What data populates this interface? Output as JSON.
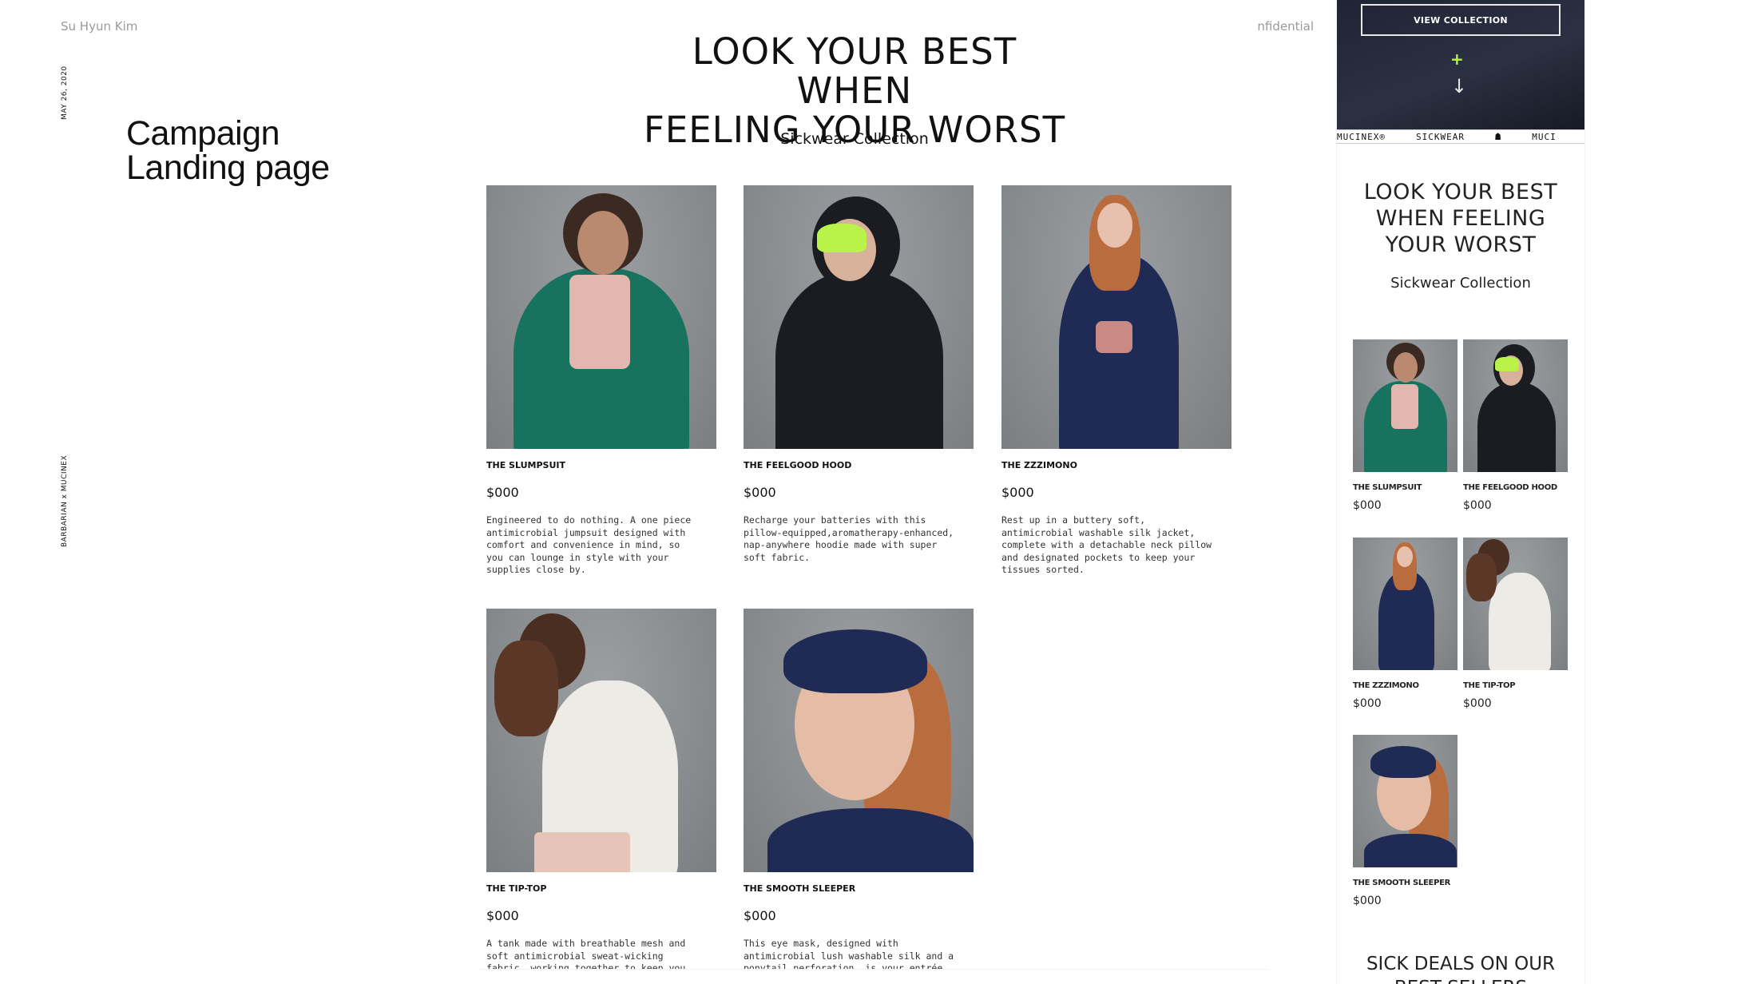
{
  "meta": {
    "author": "Su Hyun Kim",
    "confidential": "Confidential",
    "date": "MAY 26, 2020",
    "brand": "BARBARIAN x MUCINEX",
    "slide_title_line1": "Campaign",
    "slide_title_line2": "Landing page"
  },
  "landing": {
    "headline_line1": "LOOK YOUR BEST WHEN",
    "headline_line2": "FEELING YOUR WORST",
    "subhead": "Sickwear Collection",
    "products": [
      {
        "name": "THE SLUMPSUIT",
        "price": "$000",
        "description": "Engineered to do nothing. A one piece antimicrobial jumpsuit designed with comfort and convenience in mind, so you can lounge in style with your supplies close by."
      },
      {
        "name": "THE FEELGOOD HOOD",
        "price": "$000",
        "description": "Recharge your batteries with this pillow-equipped,aromatherapy-enhanced, nap-anywhere hoodie made with super soft fabric."
      },
      {
        "name": "THE ZZZIMONO",
        "price": "$000",
        "description": "Rest up in a buttery soft, antimicrobial washable silk jacket, complete with a detachable neck pillow and designated pockets to keep your tissues sorted."
      },
      {
        "name": "THE TIP-TOP",
        "price": "$000",
        "description": "A tank made with breathable mesh and soft antimicrobial sweat-wicking fabric, working together to keep you"
      },
      {
        "name": "THE  SMOOTH SLEEPER",
        "price": "$000",
        "description": "This eye mask, designed with antimicrobial lush washable silk and a ponytail perforation, is your entrée"
      }
    ]
  },
  "mobile": {
    "view_collection": "VIEW COLLECTION",
    "plus_icon": "+",
    "arrow_icon": "↓",
    "ticker": [
      "MUCINEX®",
      "SICKWEAR",
      "MUCI"
    ],
    "headline": "LOOK YOUR BEST WHEN FEELING YOUR WORST",
    "subhead": "Sickwear Collection",
    "products": [
      {
        "name": "THE SLUMPSUIT",
        "price": "$000"
      },
      {
        "name": "THE FEELGOOD HOOD",
        "price": "$000"
      },
      {
        "name": "THE ZZZIMONO",
        "price": "$000"
      },
      {
        "name": "THE TIP-TOP",
        "price": "$000"
      },
      {
        "name": "THE  SMOOTH SLEEPER",
        "price": "$000"
      }
    ],
    "deals": "SICK DEALS ON OUR BEST SELLERS"
  },
  "colors": {
    "accent_green": "#b9f34a",
    "slumpsuit_green": "#17735d",
    "navy": "#1f2a55",
    "hoodie_black": "#1b1c22"
  }
}
